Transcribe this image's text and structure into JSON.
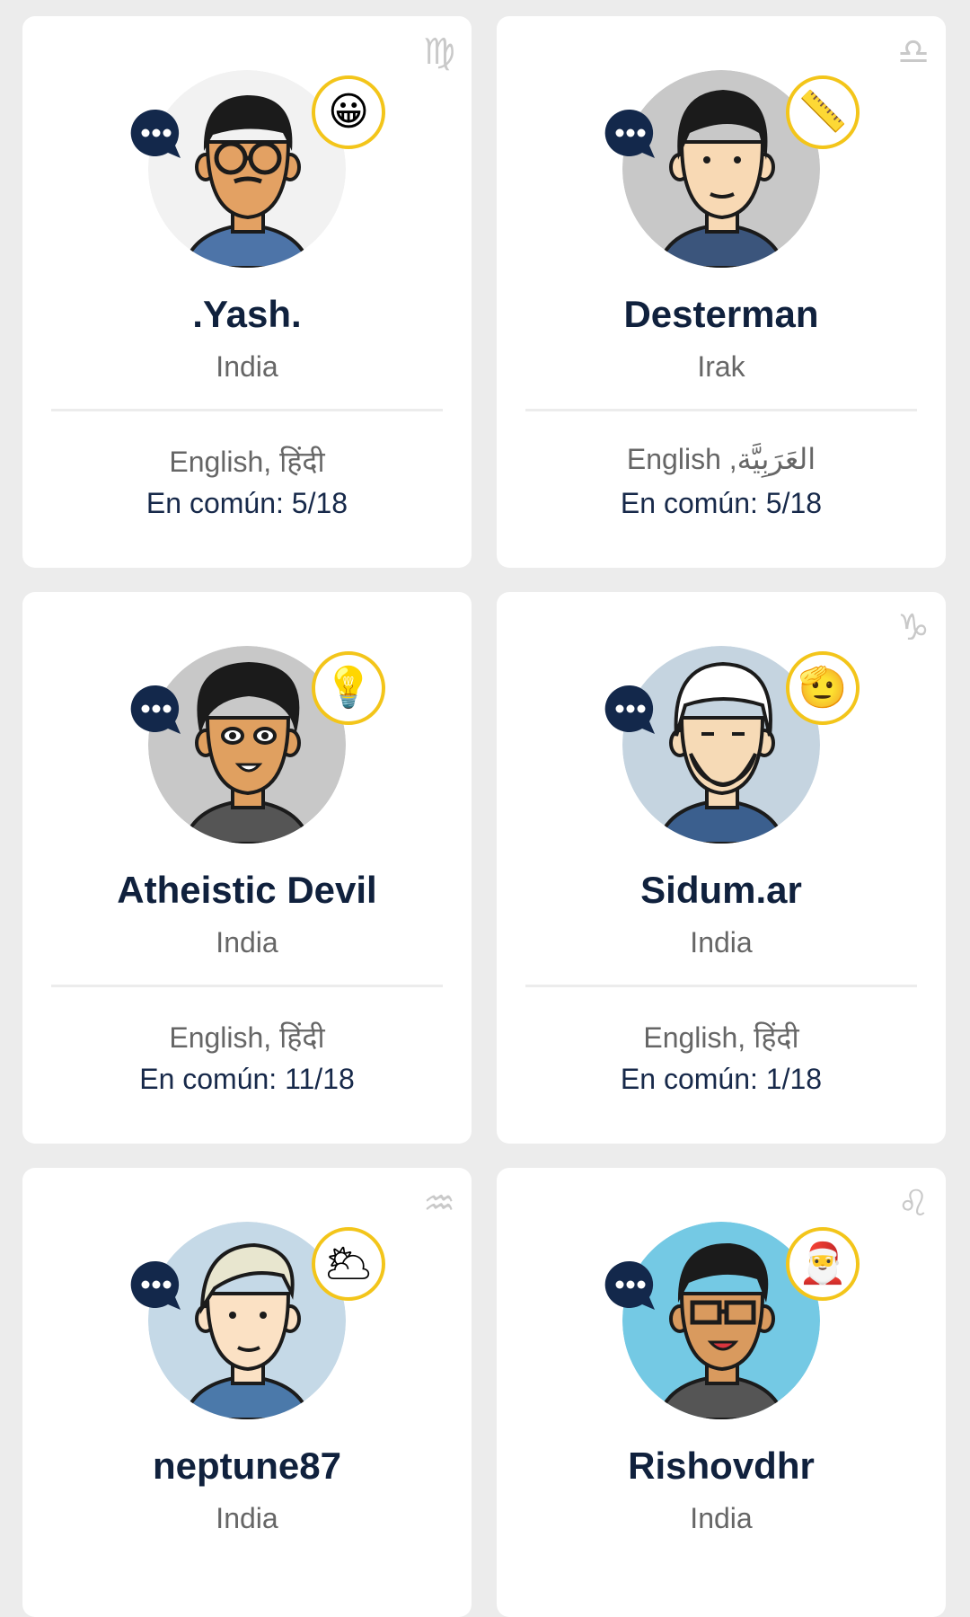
{
  "cards": [
    {
      "name": ".Yash.",
      "country": "India",
      "languages": "English, हिंदी",
      "common": "En común: 5/18",
      "zodiac": "♍",
      "zodiac_icon": "virgo-icon",
      "emoji": "😀",
      "emoji_icon": "grinning-face-icon",
      "avatar_bg": "#f2f2f2",
      "skin": "#e3a163"
    },
    {
      "name": "Desterman",
      "country": "Irak",
      "languages": "English ,العَرَبِيَّة",
      "common": "En común: 5/18",
      "zodiac": "♎",
      "zodiac_icon": "libra-icon",
      "emoji": "📏",
      "emoji_icon": "ruler-icon",
      "avatar_bg": "#c8c8c8",
      "skin": "#f8d9b4"
    },
    {
      "name": "Atheistic Devil",
      "country": "India",
      "languages": "English, हिंदी",
      "common": "En común: 11/18",
      "zodiac": "",
      "zodiac_icon": "",
      "emoji": "💡",
      "emoji_icon": "light-bulb-icon",
      "avatar_bg": "#c8c8c8",
      "skin": "#e0a060"
    },
    {
      "name": "Sidum.ar",
      "country": "India",
      "languages": "English, हिंदी",
      "common": "En común: 1/18",
      "zodiac": "♑",
      "zodiac_icon": "capricorn-icon",
      "emoji": "🫡",
      "emoji_icon": "saluting-face-icon",
      "avatar_bg": "#c5d4e0",
      "skin": "#f6dab6"
    },
    {
      "name": "neptune87",
      "country": "India",
      "languages": "",
      "common": "",
      "zodiac": "♒",
      "zodiac_icon": "aquarius-icon",
      "emoji": "🌥",
      "emoji_icon": "sun-behind-cloud-icon",
      "avatar_bg": "#c5d9e7",
      "skin": "#fbe1c4"
    },
    {
      "name": "Rishovdhr",
      "country": "India",
      "languages": "",
      "common": "",
      "zodiac": "♌",
      "zodiac_icon": "leo-icon",
      "emoji": "🎅",
      "emoji_icon": "santa-claus-icon",
      "avatar_bg": "#74c9e4",
      "skin": "#d99a5e"
    }
  ],
  "colors": {
    "name_text": "#10213d",
    "badge_ring": "#f3c51a",
    "chat_bubble": "#13284b"
  }
}
